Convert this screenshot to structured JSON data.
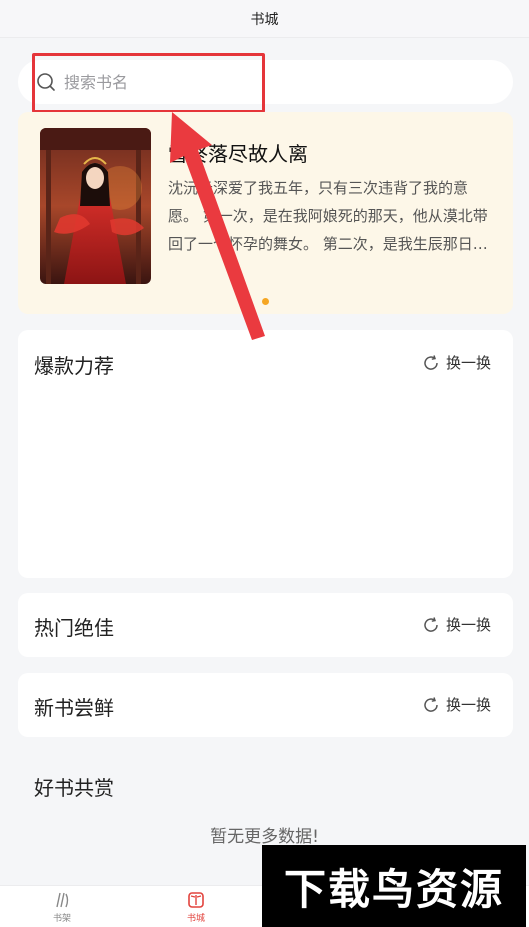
{
  "header": {
    "title": "书城"
  },
  "search": {
    "placeholder": "搜索书名"
  },
  "banner": {
    "book_title": "雪终落尽故人离",
    "description": "沈沅云深爱了我五年，只有三次违背了我的意愿。 第一次，是在我阿娘死的那天，他从漠北带回了一个怀孕的舞女。 第二次，是我生辰那日，他为了舞女冷落了我…",
    "indicator_color": "#f5a623"
  },
  "sections": [
    {
      "title": "爆款力荐",
      "refresh_label": "换一换"
    },
    {
      "title": "热门绝佳",
      "refresh_label": "换一换"
    },
    {
      "title": "新书尝鲜",
      "refresh_label": "换一换"
    }
  ],
  "plain_section": {
    "title": "好书共赏"
  },
  "empty_text": "暂无更多数据!",
  "tabbar": {
    "items": [
      {
        "label": "书架",
        "icon": "bookshelf-icon"
      },
      {
        "label": "书城",
        "icon": "book-open-icon",
        "active": true
      }
    ]
  },
  "watermark": {
    "text": "下载鸟资源"
  },
  "colors": {
    "accent": "#e2433d",
    "annotation": "#e5353a",
    "banner_bg": "#fdf7e8"
  }
}
